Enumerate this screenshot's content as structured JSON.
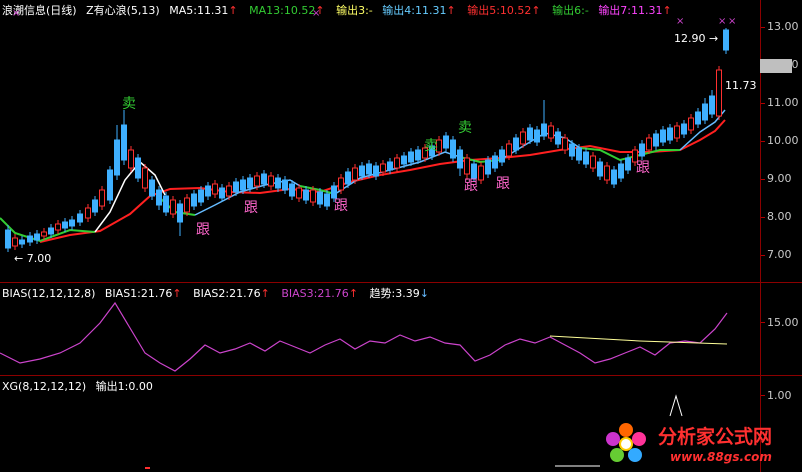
{
  "main": {
    "header": {
      "title": "浪潮信息(日线)",
      "indicator": "Z有心浪(5,13)",
      "ma5": "MA5:11.31",
      "ma13": "MA13:10.52",
      "out3": "输出3:-",
      "out4": "输出4:11.31",
      "out5": "输出5:10.52",
      "out6": "输出6:-",
      "out7": "输出7:11.31"
    },
    "axis_labels": [
      "13.00",
      "12.00",
      "11.00",
      "10.00",
      "9.00",
      "8.00",
      "7.00"
    ],
    "current_price_flag": "12.90",
    "side_label": "11.73",
    "low_label": "7.00",
    "sell_label": "卖",
    "follow_label": "跟"
  },
  "bias": {
    "header": {
      "title": "BIAS(12,12,12,8)",
      "bias1": "BIAS1:21.76",
      "bias2": "BIAS2:21.76",
      "bias3": "BIAS3:21.76",
      "trend": "趋势:3.39"
    },
    "axis_label": "15.00"
  },
  "xg": {
    "header": {
      "title": "XG(8,12,12,12)",
      "out1": "输出1:0.00"
    },
    "axis_label": "1.00"
  },
  "watermark": {
    "text": "分析家公式网",
    "url": "www.88gs.com"
  },
  "colors": {
    "up": "#ff3030",
    "down": "#3fb0ff",
    "ma5": "#ffffff",
    "ma13_red": "#ff2020",
    "green": "#33cc33",
    "magenta": "#cc44cc",
    "yellow": "#ffff66",
    "axis": "#8b0000"
  }
}
